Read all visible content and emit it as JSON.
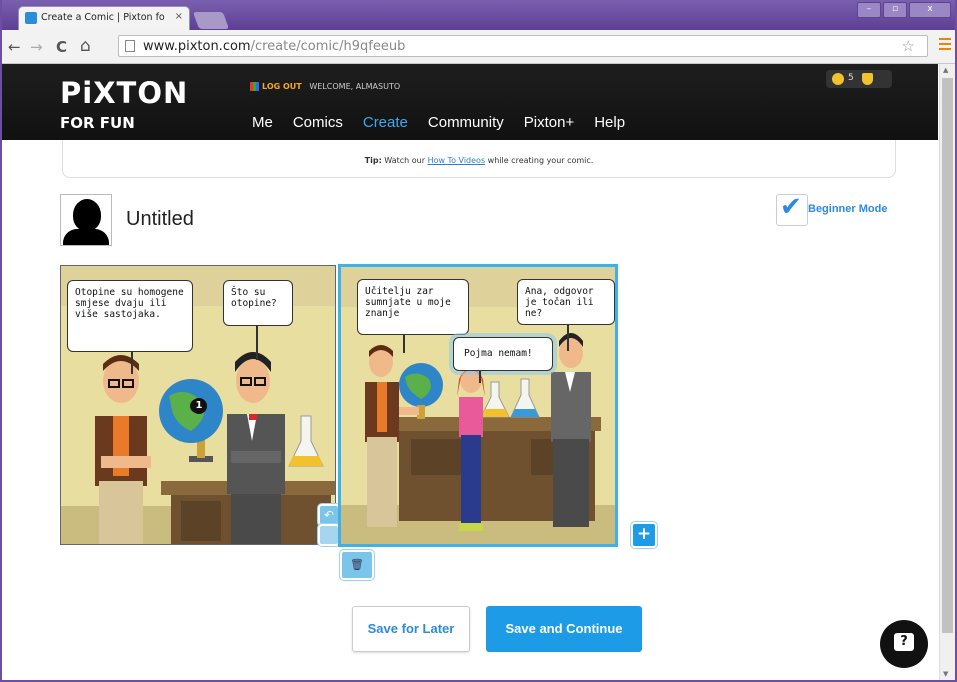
{
  "browser": {
    "tab_title": "Create a Comic | Pixton fo",
    "tab_close": "×",
    "url_domain": "www.pixton.com",
    "url_path": "/create/comic/h9qfeeub",
    "back": "←",
    "forward": "→",
    "reload": "C",
    "home": "⌂",
    "star": "☆",
    "win_min": "–",
    "win_max": "▫",
    "win_close": "x"
  },
  "site": {
    "logo": "PiXTON",
    "subbrand": "FOR FUN",
    "logout": "LOG OUT",
    "welcome": "WELCOME, ALMASUTO",
    "coins": "5",
    "nav": [
      "Me",
      "Comics",
      "Create",
      "Community",
      "Pixton+",
      "Help"
    ],
    "active_nav": "Create"
  },
  "tip": {
    "prefix": "Tip:",
    "before": " Watch our ",
    "link": "How To Videos",
    "after": " while creating your comic."
  },
  "comic": {
    "title": "Untitled",
    "beginner_mode": "Beginner Mode",
    "beginner_checked": true,
    "panel1": {
      "bubbles": [
        "Otopine su homogene smjese dvaju ili više sastojaka.",
        "Što su otopine?"
      ],
      "badge": "1"
    },
    "panel2": {
      "bubbles": [
        "Učitelju zar sumnjate u moje znanje",
        "Ana, odgovor je točan ili ne?",
        "Pojma nemam!"
      ]
    },
    "add_panel": "+",
    "undo": "↶",
    "trash": "🗑"
  },
  "actions": {
    "save_later": "Save for Later",
    "save_continue": "Save and Continue",
    "help": "?"
  },
  "colors": {
    "accent": "#1d9be6",
    "active_nav": "#3aa9f0",
    "header_bg": "#1a1a1a",
    "panel_bg": "#ece2a4"
  }
}
